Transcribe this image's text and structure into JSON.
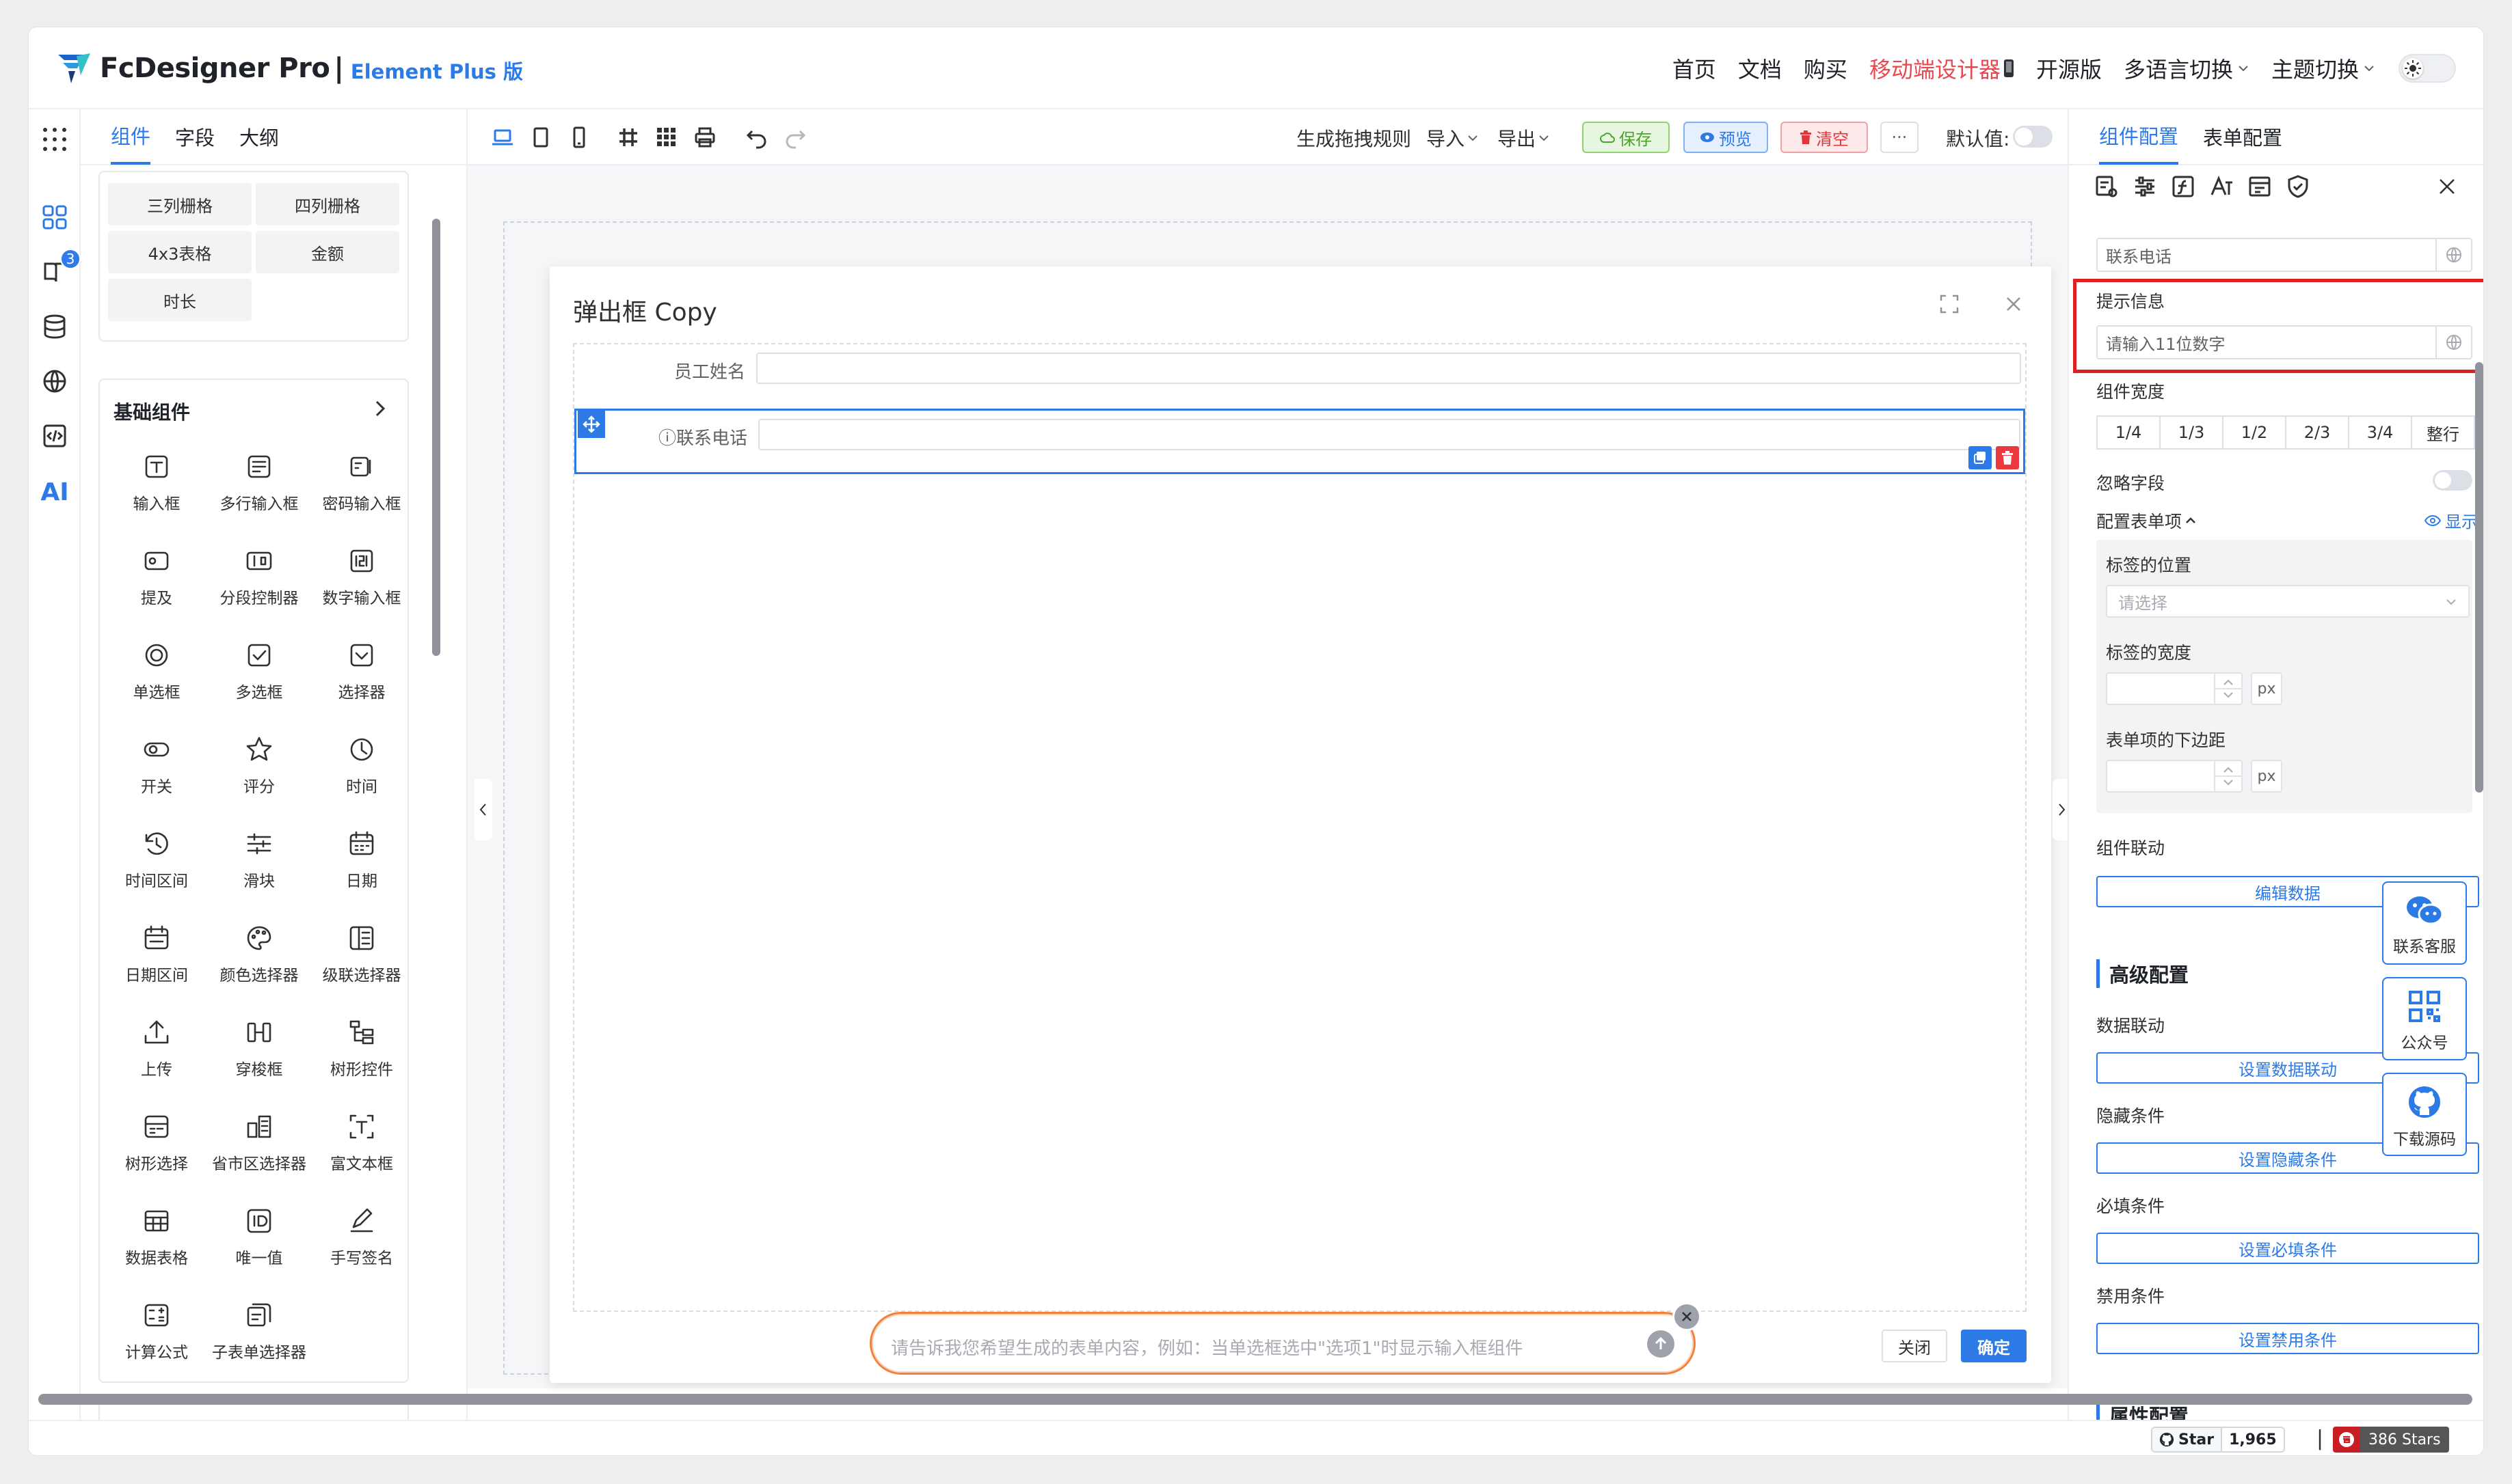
{
  "header": {
    "brand": "FcDesigner Pro",
    "separator": "|",
    "subtitle": "Element Plus 版",
    "nav": [
      {
        "label": "首页",
        "hot": false,
        "dropdown": false
      },
      {
        "label": "文档",
        "hot": false,
        "dropdown": false
      },
      {
        "label": "购买",
        "hot": false,
        "dropdown": false
      },
      {
        "label": "移动端设计器",
        "hot": true,
        "dropdown": false
      },
      {
        "label": "开源版",
        "hot": false,
        "dropdown": false
      },
      {
        "label": "多语言切换",
        "hot": false,
        "dropdown": true
      },
      {
        "label": "主题切换",
        "hot": false,
        "dropdown": true
      }
    ]
  },
  "rail": {
    "badge": "3",
    "ai_label": "AI"
  },
  "left_panel": {
    "tabs": [
      "组件",
      "字段",
      "大纲"
    ],
    "layout_items": [
      "三列栅格",
      "四列栅格",
      "4x3表格",
      "金额",
      "时长"
    ],
    "basic_title": "基础组件",
    "basic_items": [
      {
        "label": "输入框",
        "icon": "input-icon"
      },
      {
        "label": "多行输入框",
        "icon": "textarea-icon"
      },
      {
        "label": "密码输入框",
        "icon": "password-icon"
      },
      {
        "label": "提及",
        "icon": "mention-icon"
      },
      {
        "label": "分段控制器",
        "icon": "segmented-icon"
      },
      {
        "label": "数字输入框",
        "icon": "number-icon"
      },
      {
        "label": "单选框",
        "icon": "radio-icon"
      },
      {
        "label": "多选框",
        "icon": "checkbox-icon"
      },
      {
        "label": "选择器",
        "icon": "select-icon"
      },
      {
        "label": "开关",
        "icon": "switch-icon"
      },
      {
        "label": "评分",
        "icon": "star-icon"
      },
      {
        "label": "时间",
        "icon": "clock-icon"
      },
      {
        "label": "时间区间",
        "icon": "time-range-icon"
      },
      {
        "label": "滑块",
        "icon": "slider-icon"
      },
      {
        "label": "日期",
        "icon": "calendar-icon"
      },
      {
        "label": "日期区间",
        "icon": "date-range-icon"
      },
      {
        "label": "颜色选择器",
        "icon": "palette-icon"
      },
      {
        "label": "级联选择器",
        "icon": "cascader-icon"
      },
      {
        "label": "上传",
        "icon": "upload-icon"
      },
      {
        "label": "穿梭框",
        "icon": "transfer-icon"
      },
      {
        "label": "树形控件",
        "icon": "tree-icon"
      },
      {
        "label": "树形选择",
        "icon": "tree-select-icon"
      },
      {
        "label": "省市区选择器",
        "icon": "region-icon"
      },
      {
        "label": "富文本框",
        "icon": "rich-text-icon"
      },
      {
        "label": "数据表格",
        "icon": "table-icon"
      },
      {
        "label": "唯一值",
        "icon": "id-icon"
      },
      {
        "label": "手写签名",
        "icon": "signature-icon"
      },
      {
        "label": "计算公式",
        "icon": "calculator-icon"
      },
      {
        "label": "子表单选择器",
        "icon": "subform-icon"
      }
    ]
  },
  "toolbar": {
    "rules": "生成拖拽规则",
    "import": "导入",
    "export": "导出",
    "save": "保存",
    "preview": "预览",
    "clear": "清空",
    "more": "···",
    "default_label": "默认值:"
  },
  "dialog": {
    "title": "弹出框 Copy",
    "fields": [
      {
        "label": "员工姓名",
        "value": ""
      },
      {
        "label": "ⓘ联系电话",
        "value": ""
      }
    ],
    "cancel": "关闭",
    "ok": "确定"
  },
  "ai": {
    "placeholder": "请告诉我您希望生成的表单内容，例如：当单选框选中\"选项1\"时显示输入框组件"
  },
  "right_panel": {
    "tabs": [
      "组件配置",
      "表单配置"
    ],
    "field_title_value": "联系电话",
    "hint_label": "提示信息",
    "hint_value": "请输入11位数字",
    "width_label": "组件宽度",
    "widths": [
      "1/4",
      "1/3",
      "1/2",
      "2/3",
      "3/4",
      "整行"
    ],
    "ignore_label": "忽略字段",
    "form_item_label": "配置表单项",
    "form_item_show": "显示",
    "label_pos": "标签的位置",
    "label_pos_placeholder": "请选择",
    "label_width": "标签的宽度",
    "unit": "px",
    "item_margin": "表单项的下边距",
    "linkage_label": "组件联动",
    "linkage_btn": "编辑数据",
    "advanced": "高级配置",
    "data_link_label": "数据联动",
    "data_link_btn": "设置数据联动",
    "hidden_label": "隐藏条件",
    "hidden_btn": "设置隐藏条件",
    "required_label": "必填条件",
    "required_btn": "设置必填条件",
    "disabled_label": "禁用条件",
    "disabled_btn": "设置禁用条件",
    "attr_partial": "属性配置"
  },
  "widgets": [
    {
      "label": "联系客服",
      "icon": "wechat-icon"
    },
    {
      "label": "公众号",
      "icon": "qrcode-icon"
    },
    {
      "label": "下载源码",
      "icon": "github-icon"
    }
  ],
  "footer": {
    "star_label": "Star",
    "star_count": "1,965",
    "separator": "|",
    "gitee_stars": "386 Stars"
  },
  "colors": {
    "accent": "#2c7ae6",
    "hot": "#e9484e",
    "highlight": "#e02020",
    "ai_border": "#f2823b"
  }
}
